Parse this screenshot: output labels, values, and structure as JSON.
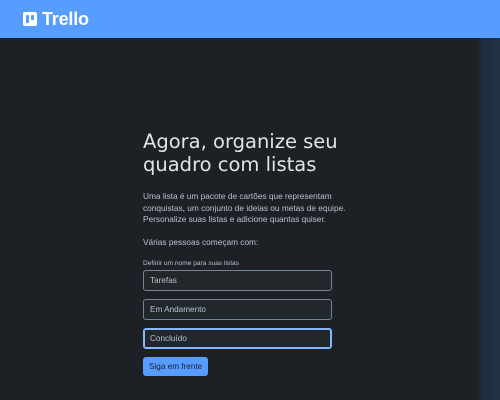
{
  "header": {
    "logo_text": "Trello",
    "logo_icon": "trello-board-icon",
    "color": "#579dff"
  },
  "onboarding": {
    "title": "Agora, organize seu quadro com listas",
    "description": "Uma lista é um pacote de cartões que representam conquistas, um conjunto de ideias ou metas de equipe. Personalize suas listas e adicione quantas quiser.",
    "subtitle": "Várias pessoas começam com:",
    "lists_label": "Definir um nome para suas listas",
    "lists": [
      {
        "value": "Tarefas"
      },
      {
        "value": "Em Andamento"
      },
      {
        "value": "Concluído"
      }
    ],
    "next_button": "Siga em frente"
  }
}
